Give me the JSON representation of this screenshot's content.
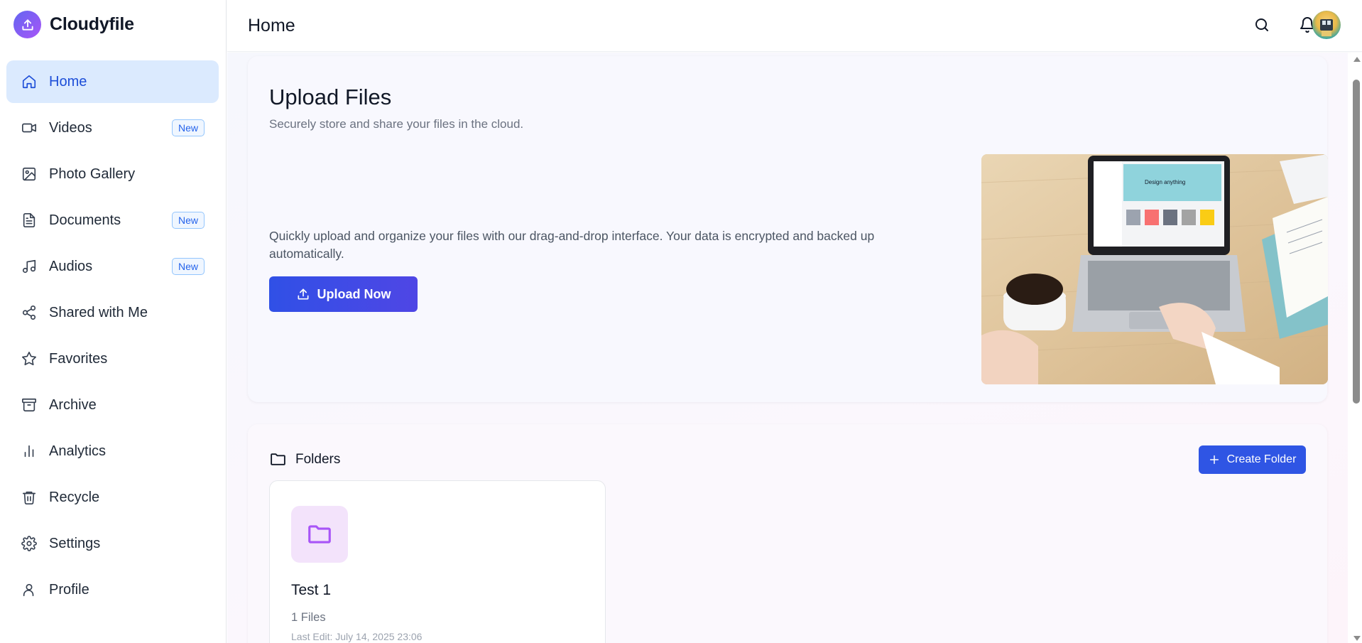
{
  "brand": {
    "name": "Cloudyfile",
    "logo_icon": "upload-icon",
    "accent": "#6366f1"
  },
  "sidebar": {
    "items": [
      {
        "label": "Home",
        "icon": "home-icon",
        "active": true,
        "badge": ""
      },
      {
        "label": "Videos",
        "icon": "video-icon",
        "active": false,
        "badge": "New"
      },
      {
        "label": "Photo Gallery",
        "icon": "image-icon",
        "active": false,
        "badge": ""
      },
      {
        "label": "Documents",
        "icon": "document-icon",
        "active": false,
        "badge": "New"
      },
      {
        "label": "Audios",
        "icon": "music-icon",
        "active": false,
        "badge": "New"
      },
      {
        "label": "Shared with Me",
        "icon": "share-icon",
        "active": false,
        "badge": ""
      },
      {
        "label": "Favorites",
        "icon": "star-icon",
        "active": false,
        "badge": ""
      },
      {
        "label": "Archive",
        "icon": "archive-icon",
        "active": false,
        "badge": ""
      },
      {
        "label": "Analytics",
        "icon": "bar-chart-icon",
        "active": false,
        "badge": ""
      },
      {
        "label": "Recycle",
        "icon": "trash-icon",
        "active": false,
        "badge": ""
      },
      {
        "label": "Settings",
        "icon": "gear-icon",
        "active": false,
        "badge": ""
      },
      {
        "label": "Profile",
        "icon": "user-icon",
        "active": false,
        "badge": ""
      }
    ]
  },
  "header": {
    "title": "Home",
    "search_icon": "search-icon",
    "notification_icon": "bell-icon",
    "avatar_icon": "avatar"
  },
  "upload": {
    "title": "Upload Files",
    "subtitle": "Securely store and share your files in the cloud.",
    "description": "Quickly upload and organize your files with our drag-and-drop interface. Your data is encrypted and backed up automatically.",
    "button_label": "Upload Now",
    "image_text": "Design anything"
  },
  "folders": {
    "title": "Folders",
    "create_label": "Create Folder",
    "items": [
      {
        "name": "Test 1",
        "count": "1 Files",
        "last_edit": "Last Edit: July 14, 2025 23:06"
      }
    ]
  },
  "colors": {
    "primary": "#2f55e4",
    "active_bg": "#dbeafe",
    "active_text": "#1d4ed8",
    "folder_icon": "#a855f7",
    "folder_icon_bg": "#f3e3fb"
  }
}
